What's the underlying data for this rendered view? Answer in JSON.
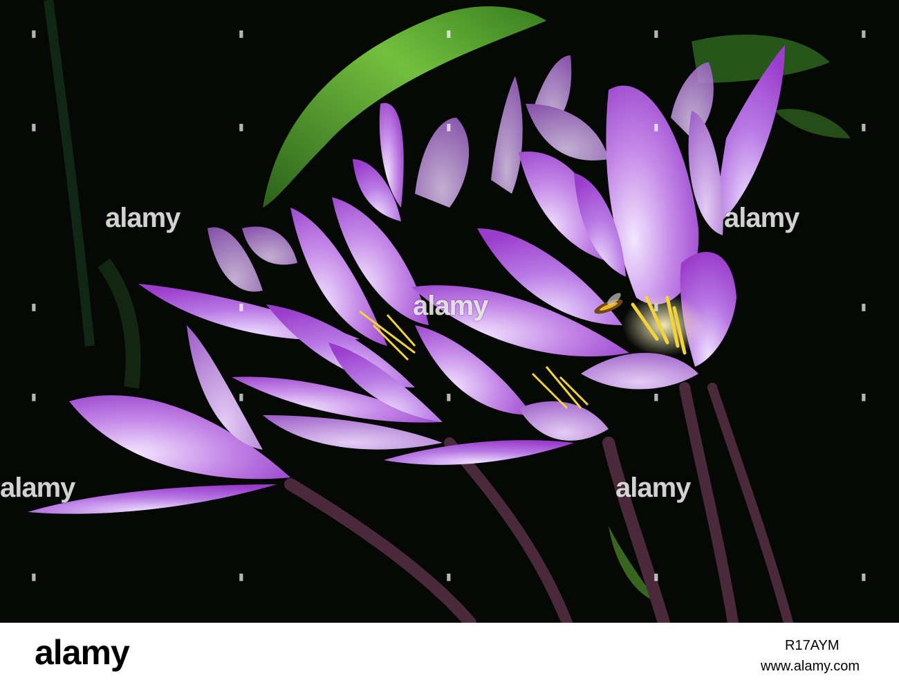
{
  "watermark": {
    "text": "alamy"
  },
  "footer": {
    "logo": "alamy",
    "image_id": "R17AYM",
    "url": "www.alamy.com"
  },
  "colors": {
    "background": "#050805",
    "petal_light": "#d9b8f2",
    "petal_mid": "#b36ee0",
    "petal_deep": "#8e2fc4",
    "stamen": "#f2d43a",
    "leaf": "#6fc83a",
    "stem": "#4a2a3a"
  }
}
